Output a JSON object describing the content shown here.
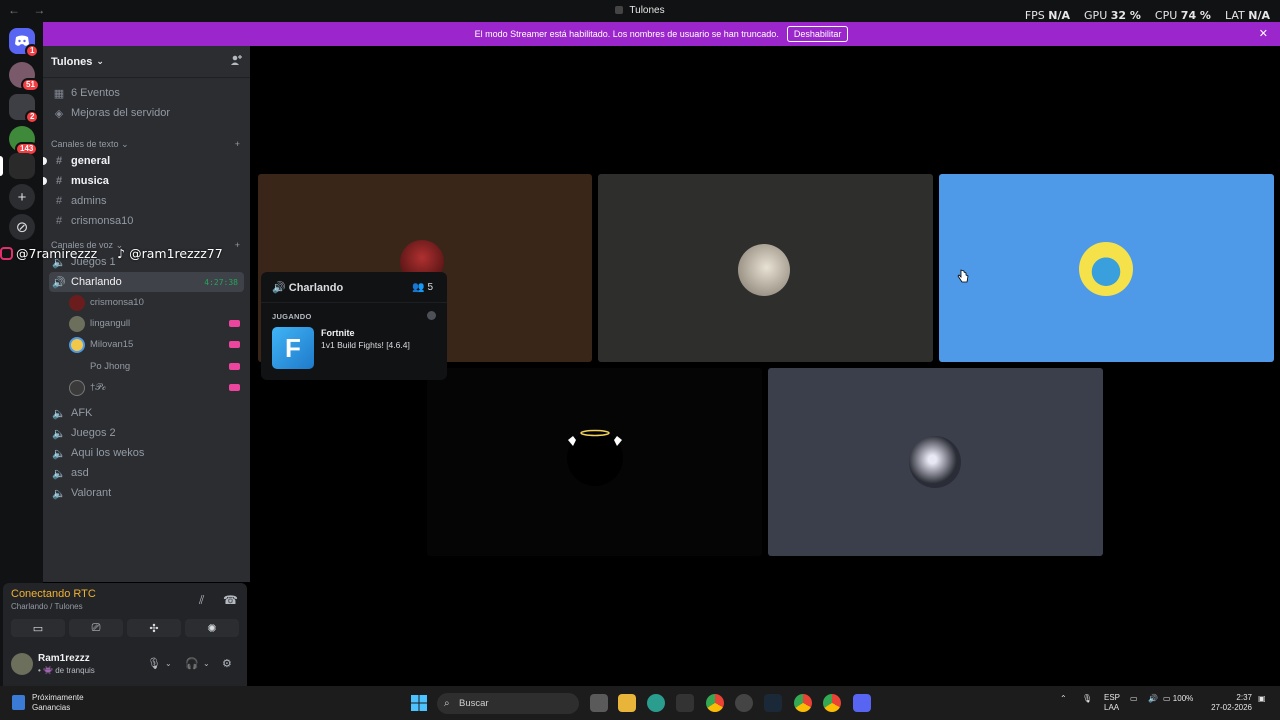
{
  "titlebar": {
    "title": "Tulones",
    "back": "←",
    "forward": "→"
  },
  "overlay": {
    "fps_label": "FPS",
    "fps_value": "N/A",
    "gpu_label": "GPU",
    "gpu_value": "32 %",
    "cpu_label": "CPU",
    "cpu_value": "74 %",
    "lat_label": "LAT",
    "lat_value": "N/A"
  },
  "rail": {
    "badges": [
      "1",
      "51",
      "2",
      "143"
    ],
    "add_icon": "+",
    "discover_icon": "⊘"
  },
  "banner": {
    "text": "El modo Streamer está habilitado. Los nombres de usuario se han truncado.",
    "button": "Deshabilitar",
    "close": "✕"
  },
  "server": {
    "name": "Tulones",
    "chevron": "⌄"
  },
  "sidebar": {
    "events": "6 Eventos",
    "boosts": "Mejoras del servidor",
    "text_category": "Canales de texto",
    "voice_category": "Canales de voz",
    "text_channels": [
      "general",
      "musica",
      "admins",
      "crismonsa10"
    ],
    "voice_channels": [
      "Juegos 1",
      "Charlando",
      "AFK",
      "Juegos 2",
      "Aqui los wekos",
      "asd",
      "Valorant"
    ],
    "active_timer": "4:27:38",
    "voice_users": [
      "crismonsa10",
      "lingangull",
      "Milovan15",
      "Po Jhong",
      "†𝒫𝒸"
    ]
  },
  "voice_panel": {
    "status": "Conectando RTC",
    "location": "Charlando / Tulones",
    "username": "Ram1rezzz",
    "user_status": "• 👾 de tranquis"
  },
  "popout": {
    "channel": "Charlando",
    "count": "5",
    "section": "JUGANDO",
    "game": "Fortnite",
    "detail": "1v1 Build Fights! [4.6.4]",
    "game_letter": "F"
  },
  "social": {
    "instagram": "@7ramirezzz",
    "tiktok": "@ram1rezzz77"
  },
  "taskbar": {
    "news_line1": "Próximamente",
    "news_line2": "Ganancias",
    "search": "Buscar",
    "lang1": "ESP",
    "lang2": "LAA",
    "battery": "100%",
    "time": "2:37",
    "date": "27-02-2026"
  },
  "colors": {
    "accent": "#5865f2",
    "banner": "#9b27cc",
    "rtc": "#f0b232",
    "speaking": "#23a55a",
    "live": "#eb459e",
    "tile_brown": "#3a2519",
    "tile_gray": "#2e2e2c",
    "tile_blue": "#4e9ae8",
    "tile_slate": "#3b3f4c"
  }
}
